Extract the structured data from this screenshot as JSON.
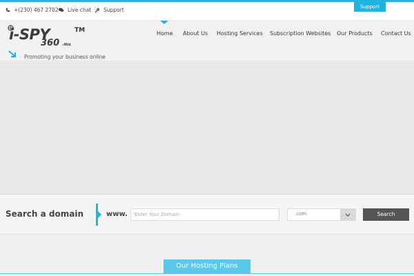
{
  "topbar": {
    "phone": "+(230) 467 2702",
    "live_chat": "Live chat",
    "support": "Support",
    "support_tab": "Support"
  },
  "logo": {
    "main_text": "i-SPY",
    "sub_text": "360",
    "domain_text": ".mu",
    "trademark": "TM",
    "tagline": "Promoting your business online"
  },
  "nav": {
    "items": [
      {
        "label": "Home",
        "active": true
      },
      {
        "label": "About Us"
      },
      {
        "label": "Hosting Services"
      },
      {
        "label": "Subscription Websites"
      },
      {
        "label": "Our Products"
      },
      {
        "label": "Contact Us"
      }
    ]
  },
  "domain_search": {
    "title": "Search a domain",
    "prefix": "www.",
    "placeholder": "Enter Your Domain",
    "tld_selected": ".com",
    "button_label": "Search"
  },
  "plans": {
    "title": "Our Hosting Plans"
  },
  "colors": {
    "accent": "#1fb5e0",
    "plans_accent": "#5bc8ea",
    "button_dark": "#555555"
  }
}
